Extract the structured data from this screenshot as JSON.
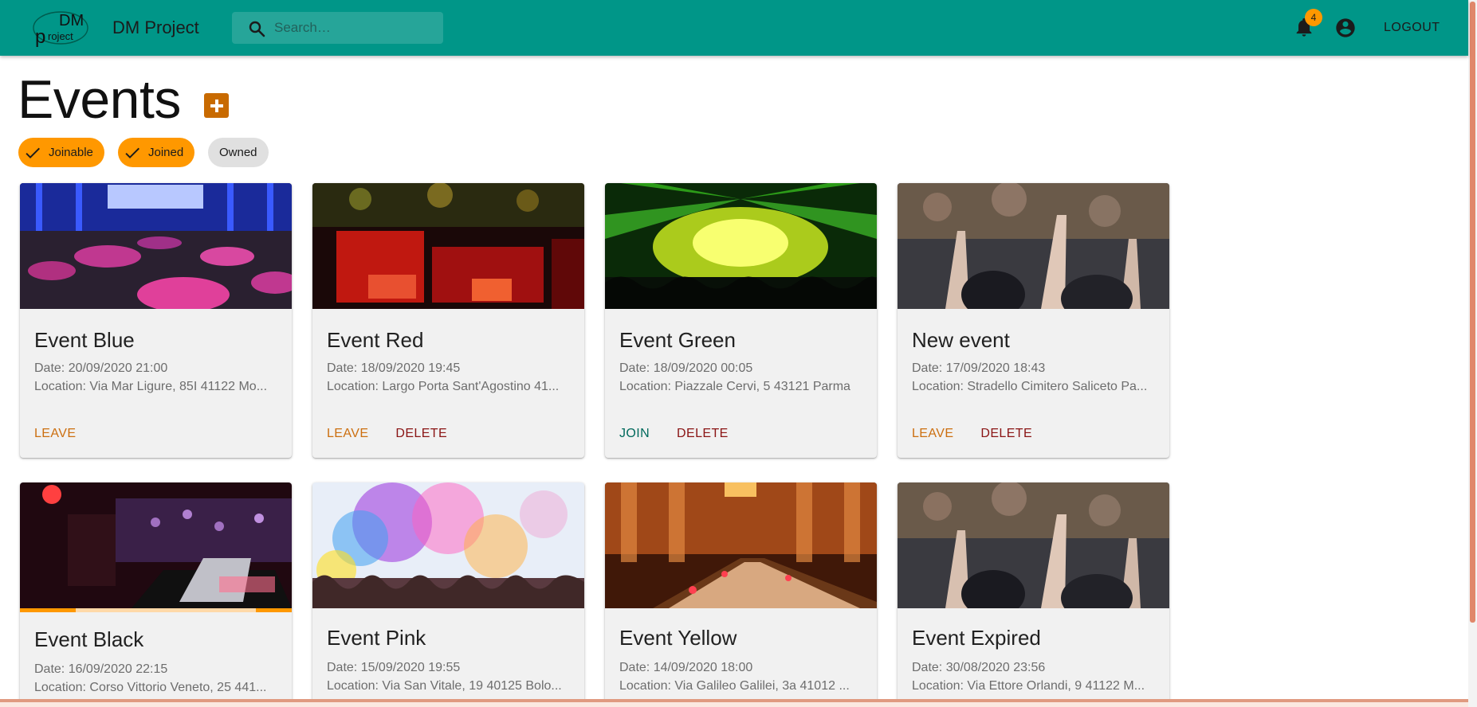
{
  "app": {
    "title": "DM Project",
    "logo_text": "DM project",
    "search_placeholder": "Search…",
    "notification_count": "4",
    "logout_label": "LOGOUT"
  },
  "page": {
    "title": "Events"
  },
  "filters": [
    {
      "label": "Joinable",
      "selected": true
    },
    {
      "label": "Joined",
      "selected": true
    },
    {
      "label": "Owned",
      "selected": false
    }
  ],
  "events": [
    {
      "title": "Event Blue",
      "date": "Date: 20/09/2020 21:00",
      "location": "Location: Via Mar Ligure, 85I 41122 Mo...",
      "actions": [
        "LEAVE"
      ],
      "image": "banquet-blue-icon"
    },
    {
      "title": "Event Red",
      "date": "Date: 18/09/2020 19:45",
      "location": "Location: Largo Porta Sant'Agostino 41...",
      "actions": [
        "LEAVE",
        "DELETE"
      ],
      "image": "lounge-red-icon"
    },
    {
      "title": "Event Green",
      "date": "Date: 18/09/2020 00:05",
      "location": "Location: Piazzale Cervi, 5 43121 Parma",
      "actions": [
        "JOIN",
        "DELETE"
      ],
      "image": "concert-green-icon"
    },
    {
      "title": "New event",
      "date": "Date: 17/09/2020 18:43",
      "location": "Location: Stradello Cimitero Saliceto Pa...",
      "actions": [
        "LEAVE",
        "DELETE"
      ],
      "image": "crowd-icon"
    },
    {
      "title": "Event Black",
      "date": "Date: 16/09/2020 22:15",
      "location": "Location: Corso Vittorio Veneto, 25 441...",
      "actions": [],
      "image": "dj-icon",
      "loading": true
    },
    {
      "title": "Event Pink",
      "date": "Date: 15/09/2020 19:55",
      "location": "Location: Via San Vitale, 19 40125 Bolo...",
      "actions": [],
      "image": "holi-colors-icon"
    },
    {
      "title": "Event Yellow",
      "date": "Date: 14/09/2020 18:00",
      "location": "Location: Via Galileo Galilei, 3a 41012 ...",
      "actions": [],
      "image": "dinner-hall-icon"
    },
    {
      "title": "Event Expired",
      "date": "Date: 30/08/2020 23:56",
      "location": "Location: Via Ettore Orlandi, 9 41122 M...",
      "actions": [],
      "image": "crowd-icon"
    }
  ],
  "colors": {
    "primary": "#009688",
    "accent": "#ff9800",
    "add_button": "#c86a00",
    "leave": "#cc6f10",
    "delete": "#8a1414",
    "join": "#00695c"
  }
}
